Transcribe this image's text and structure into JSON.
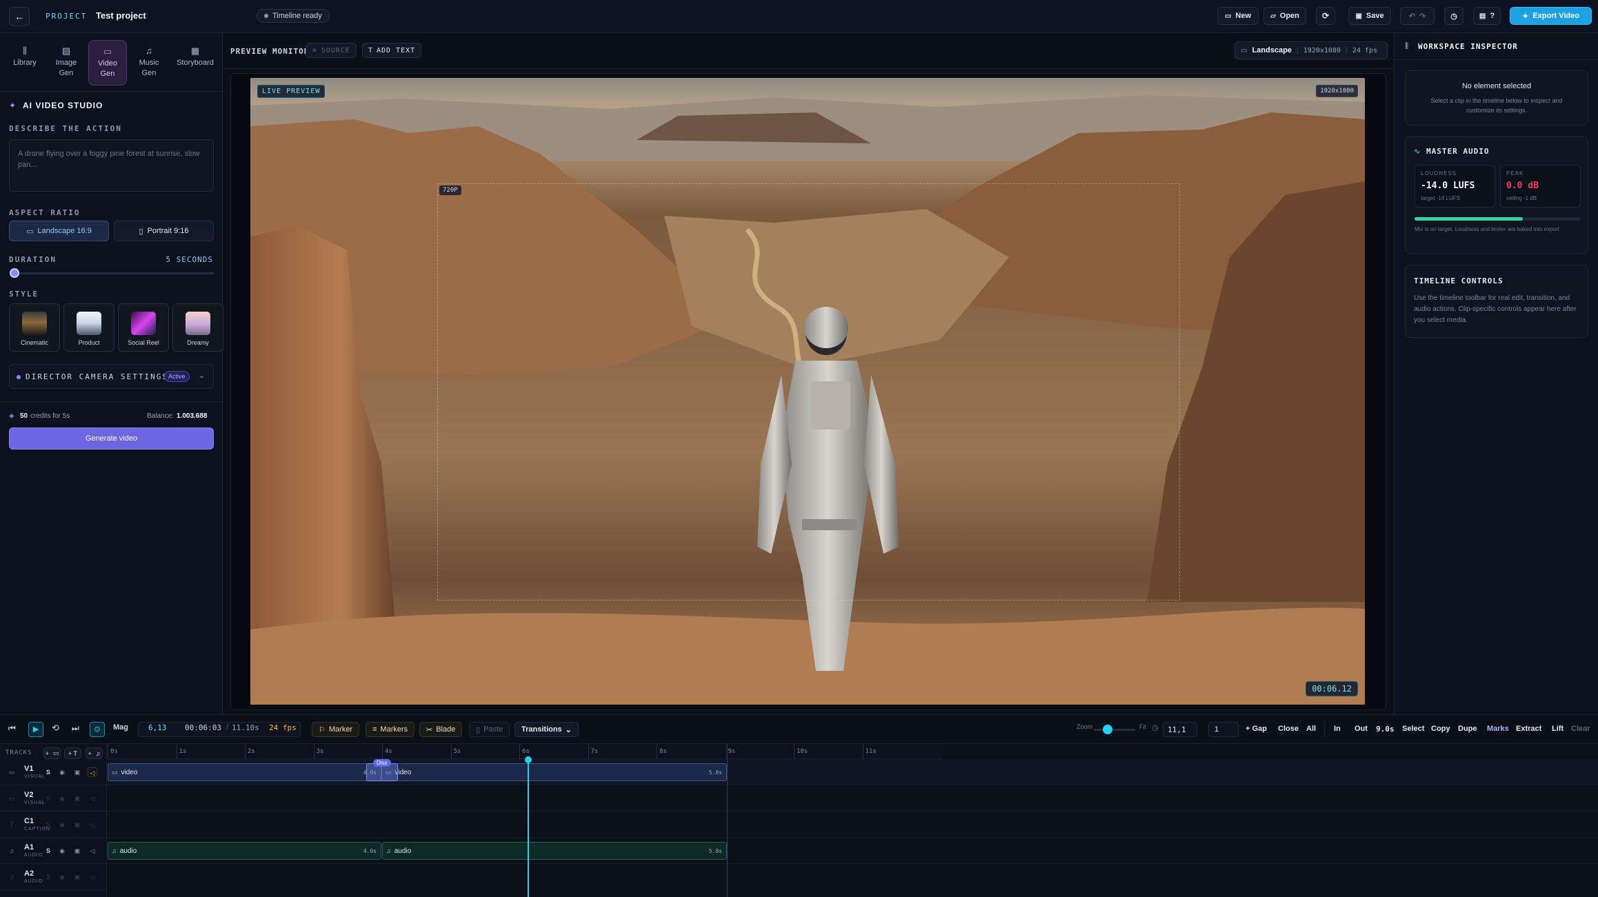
{
  "header": {
    "project_label": "PROJECT",
    "project_name": "Test project",
    "status": "Timeline ready",
    "new_label": "New",
    "open_label": "Open",
    "save_label": "Save",
    "shortcuts_label": "?",
    "export_label": "Export Video"
  },
  "nav_tabs": [
    {
      "label": "Library",
      "icon": "library-icon"
    },
    {
      "label": "Image Gen",
      "icon": "image-icon"
    },
    {
      "label": "Video Gen",
      "icon": "video-icon"
    },
    {
      "label": "Music Gen",
      "icon": "music-icon"
    },
    {
      "label": "Storyboard",
      "icon": "storyboard-icon"
    }
  ],
  "studio": {
    "title": "AI VIDEO STUDIO",
    "describe_label": "DESCRIBE THE ACTION",
    "prompt_placeholder": "A drone flying over a foggy pine forest at sunrise, slow pan...",
    "aspect_label": "ASPECT RATIO",
    "aspect_landscape": "Landscape 16:9",
    "aspect_portrait": "Portrait 9:16",
    "duration_label": "DURATION",
    "duration_value": "5 SECONDS",
    "duration_fraction": 0.0,
    "style_label": "STYLE",
    "styles": [
      "Cinematic",
      "Product",
      "Social Reel",
      "Dreamy"
    ],
    "camera_label": "DIRECTOR CAMERA SETTINGS",
    "camera_badge": "Active",
    "credits_value": "50",
    "credits_text": "credits for 5s",
    "balance_label": "Balance:",
    "balance_value": "1.003.688",
    "generate_label": "Generate video"
  },
  "monitor": {
    "title": "PREVIEW MONITOR",
    "source_label": "SOURCE",
    "add_text_label": "ADD TEXT",
    "orientation": "Landscape",
    "resolution": "1920x1080",
    "fps": "24 fps",
    "live_badge": "LIVE PREVIEW",
    "res_badge": "1920x1080",
    "safe_badge": "720P",
    "timecode": "00:06.12"
  },
  "inspector": {
    "title": "WORKSPACE INSPECTOR",
    "empty_title": "No element selected",
    "empty_text": "Select a clip in the timeline below to inspect and customize its settings.",
    "audio_title": "MASTER AUDIO",
    "loudness_label": "LOUDNESS",
    "loudness_value": "-14.0 LUFS",
    "loudness_target": "target -14 LUFS",
    "peak_label": "PEAK",
    "peak_value": "0.0 dB",
    "peak_ceiling": "ceiling -1 dB",
    "meter_fraction": 0.65,
    "audio_note": "Mix is on target. Loudness and limiter are baked into export.",
    "controls_title": "TIMELINE CONTROLS",
    "controls_text": "Use the timeline toolbar for real edit, transition, and audio actions. Clip-specific controls appear here after you select media."
  },
  "timeline": {
    "mag_label": "Mag",
    "frame": "6,13",
    "time_current": "00:06:03",
    "time_total": "11.10s",
    "fps": "24 fps",
    "marker_label": "Marker",
    "markers_label": "Markers",
    "blade_label": "Blade",
    "paste_label": "Paste",
    "transitions_label": "Transitions",
    "zoom_label": "Zoom",
    "fit_label": "Fit",
    "zoom_value": "11,1",
    "gap_value": "1",
    "gap_label": "+ Gap",
    "close_label": "Close",
    "all_label": "All",
    "in_label": "In",
    "out_label": "Out",
    "out_value": "9.0s",
    "select_label": "Select",
    "copy_label": "Copy",
    "dupe_label": "Dupe",
    "marks_label": "Marks",
    "extract_label": "Extract",
    "lift_label": "Lift",
    "clear_label": "Clear",
    "tracks_label": "TRACKS",
    "add_video": "+",
    "add_text": "+ T",
    "add_audio": "+",
    "ruler": [
      "0s",
      "1s",
      "2s",
      "3s",
      "4s",
      "5s",
      "6s",
      "7s",
      "8s",
      "9s",
      "10s",
      "11s"
    ],
    "tracks": [
      {
        "name": "V1",
        "sub": "VISUAL"
      },
      {
        "name": "V2",
        "sub": "VISUAL"
      },
      {
        "name": "C1",
        "sub": "CAPTION"
      },
      {
        "name": "A1",
        "sub": "AUDIO"
      },
      {
        "name": "A2",
        "sub": "AUDIO"
      }
    ],
    "clips": {
      "v1a_label": "video",
      "v1a_dur": "4.0s",
      "v1b_label": "video",
      "v1b_dur": "5.0s",
      "transition": "Diss",
      "a1a_label": "audio",
      "a1a_dur": "4.0s",
      "a1b_label": "audio",
      "a1b_dur": "5.0s"
    },
    "playhead_seconds": 6.13
  },
  "colors": {
    "accent": "#22d3ee",
    "brand": "#6d67e4",
    "export": "#1da1e2",
    "video_gen_active": "#2a1f3d",
    "peak": "#f43f5e",
    "meter": "#34d399"
  }
}
